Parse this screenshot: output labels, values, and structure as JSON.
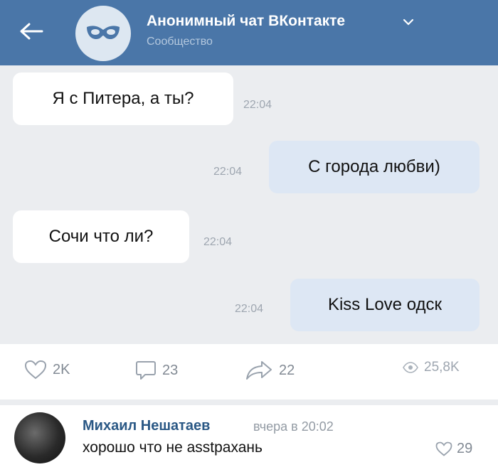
{
  "header": {
    "title": "Анонимный чат ВКонтакте",
    "subtitle": "Сообщество"
  },
  "messages": [
    {
      "text": "Я с Питера, а ты?",
      "time": "22:04",
      "direction": "incoming"
    },
    {
      "text": "С города любви)",
      "time": "22:04",
      "direction": "outgoing"
    },
    {
      "text": "Сочи что ли?",
      "time": "22:04",
      "direction": "incoming"
    },
    {
      "text": "Kiss Love одск",
      "time": "22:04",
      "direction": "outgoing"
    }
  ],
  "actions": {
    "likes": "2K",
    "comments": "23",
    "shares": "22",
    "views": "25,8K"
  },
  "comment": {
    "author": "Михаил Нешатаев",
    "time": "вчера в 20:02",
    "text": "хорошо что не аsstрахань",
    "likes": "29"
  },
  "colors": {
    "header_bg": "#4a76a8",
    "link": "#2a5885",
    "outgoing_bubble": "#dde7f4",
    "background": "#ebedf0"
  }
}
